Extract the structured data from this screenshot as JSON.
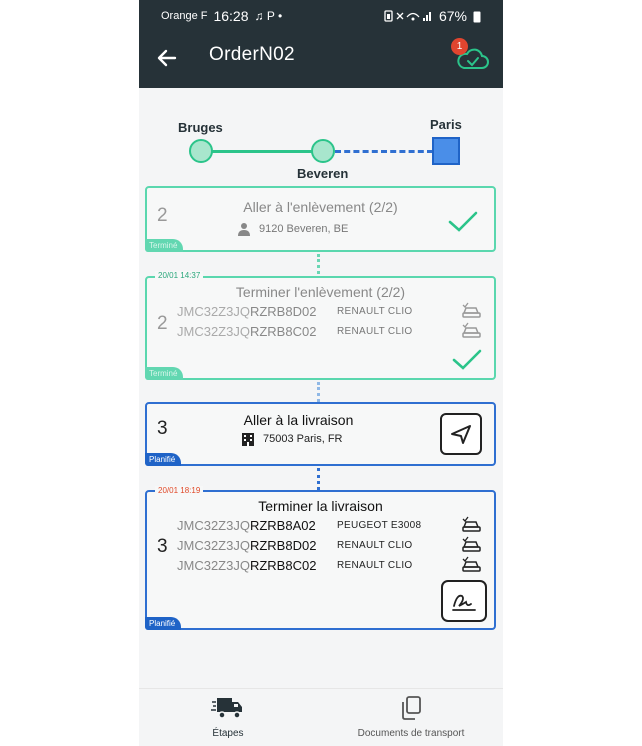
{
  "status": {
    "carrier": "Orange F",
    "time": "16:28",
    "extra": "♫  P  •",
    "battery": "67%"
  },
  "appbar": {
    "title": "OrderN02",
    "badge_count": "1"
  },
  "route": {
    "origin": "Bruges",
    "via": "Beveren",
    "destination": "Paris"
  },
  "steps": [
    {
      "num": "2",
      "title": "Aller à l'enlèvement (2/2)",
      "address": "9120 Beveren, BE",
      "status": "Terminé"
    },
    {
      "timestamp": "20/01 14:37",
      "num": "2",
      "title": "Terminer l'enlèvement (2/2)",
      "status": "Terminé",
      "vehicles": [
        {
          "vin_prefix": "JMC32Z3JQ",
          "vin_suffix": "RZRB8D02",
          "model": "RENAULT CLIO"
        },
        {
          "vin_prefix": "JMC32Z3JQ",
          "vin_suffix": "RZRB8C02",
          "model": "RENAULT CLIO"
        }
      ]
    },
    {
      "num": "3",
      "title": "Aller à la livraison",
      "address": "75003 Paris, FR",
      "status": "Planifié"
    },
    {
      "timestamp": "20/01 18:19",
      "num": "3",
      "title": "Terminer la livraison",
      "status": "Planifié",
      "vehicles": [
        {
          "vin_prefix": "JMC32Z3JQ",
          "vin_suffix": "RZRB8A02",
          "model": "PEUGEOT E3008"
        },
        {
          "vin_prefix": "JMC32Z3JQ",
          "vin_suffix": "RZRB8D02",
          "model": "RENAULT CLIO"
        },
        {
          "vin_prefix": "JMC32Z3JQ",
          "vin_suffix": "RZRB8C02",
          "model": "RENAULT CLIO"
        }
      ]
    }
  ],
  "nav": {
    "steps_label": "Étapes",
    "docs_label": "Documents de transport"
  },
  "colors": {
    "appbar": "#263238",
    "done": "#5ad7ae",
    "planned": "#2f6fd1",
    "badge": "#e0452f"
  },
  "icons": [
    "arrow-left-icon",
    "cloud-check-icon",
    "person-icon",
    "building-icon",
    "navigation-icon",
    "car-check-icon",
    "signature-icon",
    "truck-icon",
    "documents-icon",
    "check-icon"
  ]
}
